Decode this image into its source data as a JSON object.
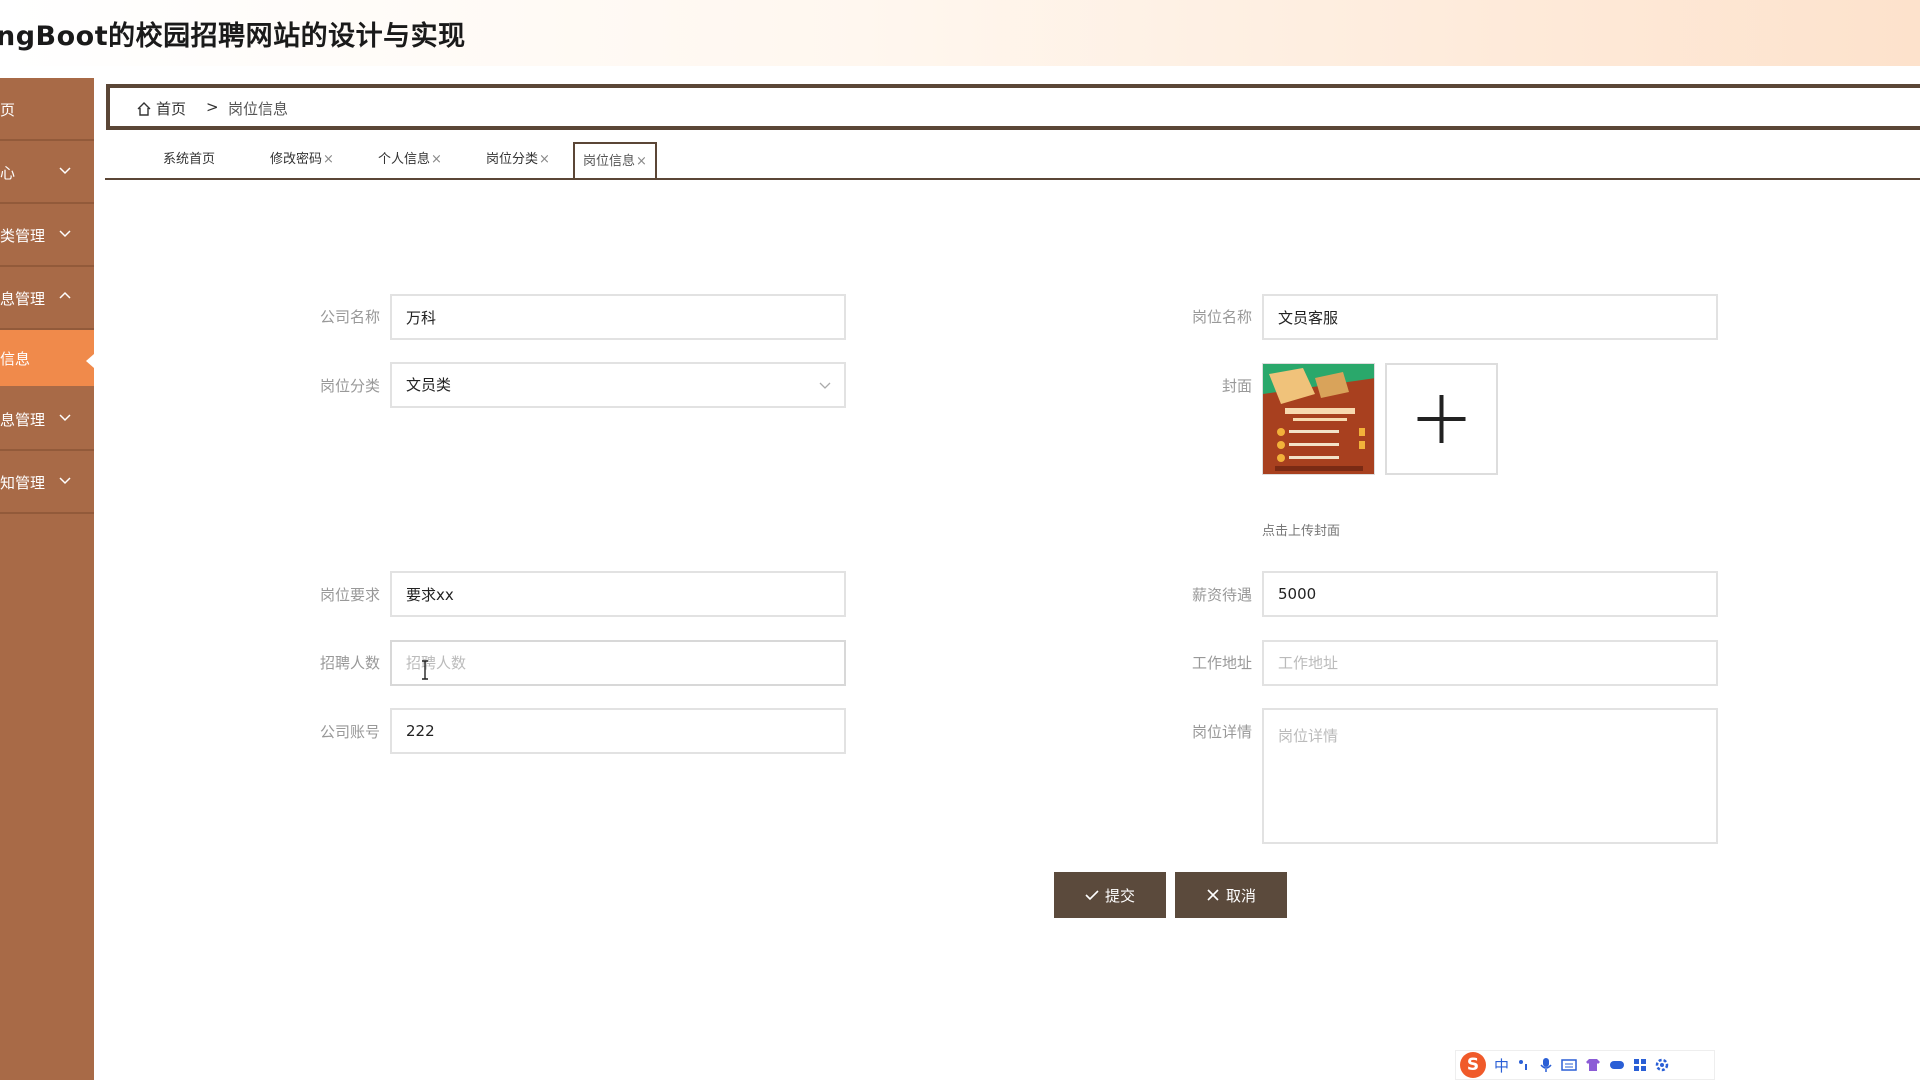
{
  "header": {
    "title": "ngBoot的校园招聘网站的设计与实现"
  },
  "sidebar": {
    "items": [
      {
        "label": "页",
        "expandable": false
      },
      {
        "label": "心",
        "expandable": true
      },
      {
        "label": "类管理",
        "expandable": true
      },
      {
        "label": "息管理",
        "expandable": true,
        "expanded": true
      },
      {
        "label": "信息",
        "active": true
      },
      {
        "label": "息管理",
        "expandable": true
      },
      {
        "label": "知管理",
        "expandable": true
      }
    ]
  },
  "breadcrumb": {
    "home": "首页",
    "separator": ">",
    "current": "岗位信息"
  },
  "tabs": [
    {
      "label": "系统首页",
      "closable": false
    },
    {
      "label": "修改密码",
      "closable": true
    },
    {
      "label": "个人信息",
      "closable": true
    },
    {
      "label": "岗位分类",
      "closable": true
    },
    {
      "label": "岗位信息",
      "closable": true,
      "active": true
    }
  ],
  "tab_close_glyph": "×",
  "form": {
    "company_name": {
      "label": "公司名称",
      "value": "万科"
    },
    "job_name": {
      "label": "岗位名称",
      "value": "文员客服"
    },
    "job_category": {
      "label": "岗位分类",
      "value": "文员类"
    },
    "cover": {
      "label": "封面",
      "hint": "点击上传封面"
    },
    "requirements": {
      "label": "岗位要求",
      "value": "要求xx"
    },
    "salary": {
      "label": "薪资待遇",
      "value": "5000"
    },
    "headcount": {
      "label": "招聘人数",
      "value": "",
      "placeholder": "招聘人数"
    },
    "address": {
      "label": "工作地址",
      "value": "",
      "placeholder": "工作地址"
    },
    "company_account": {
      "label": "公司账号",
      "value": "222"
    },
    "details": {
      "label": "岗位详情",
      "value": "",
      "placeholder": "岗位详情"
    }
  },
  "buttons": {
    "submit": "提交",
    "cancel": "取消"
  },
  "ime": {
    "mode": "中"
  },
  "colors": {
    "sidebar": "#a86a47",
    "sidebar_active": "#f08a4b",
    "button": "#5b4a3c",
    "border_dark": "#5b4636"
  }
}
